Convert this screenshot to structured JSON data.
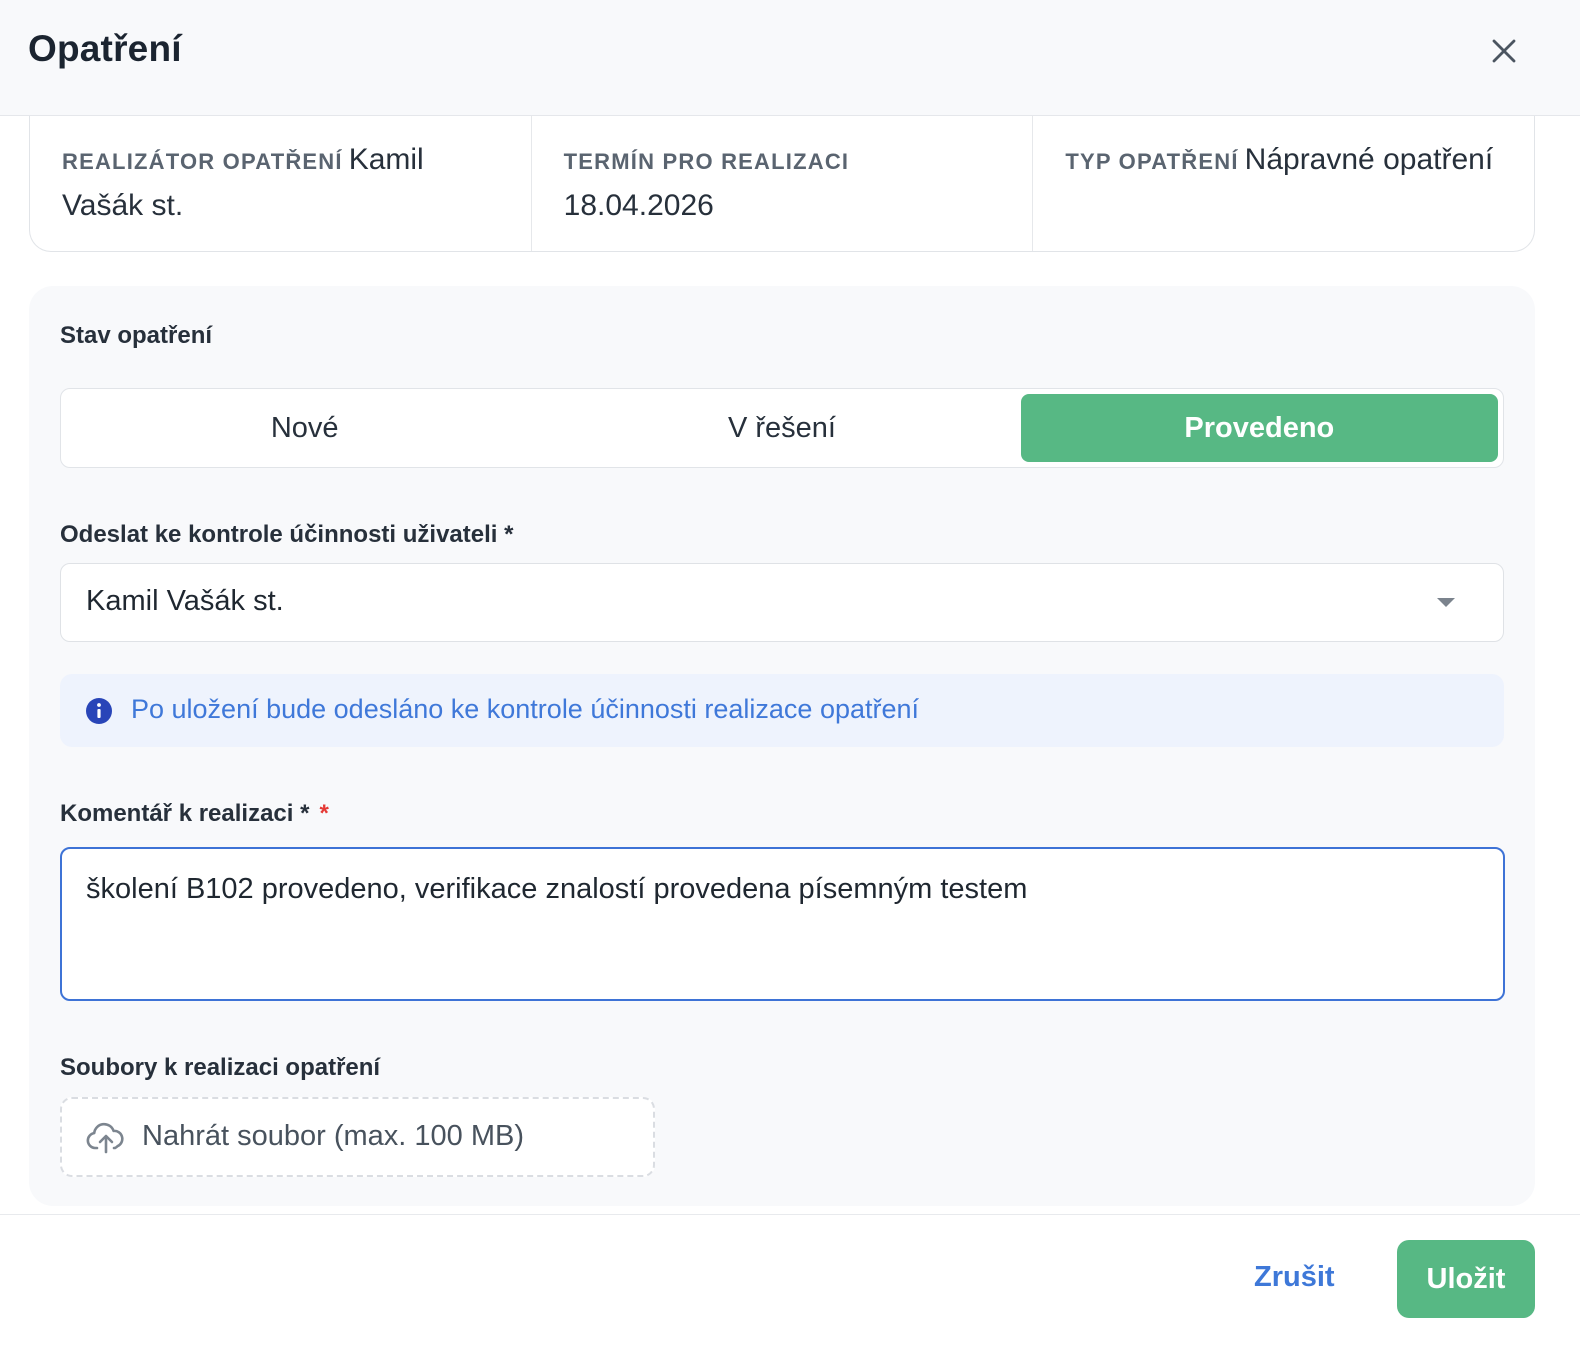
{
  "header": {
    "title": "Opatření",
    "close_icon": "close-icon"
  },
  "info": {
    "realizator": {
      "label": "Realizátor opatření",
      "value": "Kamil Vašák st."
    },
    "termin": {
      "label": "Termín pro realizaci",
      "value": "18.04.2026"
    },
    "typ": {
      "label": "Typ opatření",
      "value": "Nápravné opatření"
    }
  },
  "form": {
    "status": {
      "label": "Stav opatření",
      "options": [
        "Nové",
        "V řešení",
        "Provedeno"
      ],
      "selected": "Provedeno"
    },
    "reviewer": {
      "label": "Odeslat ke kontrole účinnosti uživateli *",
      "value": "Kamil Vašák st."
    },
    "notice": {
      "icon": "info-icon",
      "text": "Po uložení bude odesláno ke kontrole účinnosti realizace opatření"
    },
    "comment": {
      "label": "Komentář k realizaci *",
      "required_marker": "*",
      "value": "školení B102 provedeno, verifikace znalostí provedena písemným testem"
    },
    "files": {
      "label": "Soubory k realizaci opatření",
      "upload_icon": "cloud-upload-icon",
      "upload_label": "Nahrát soubor (max. 100 MB)"
    }
  },
  "footer": {
    "cancel_label": "Zrušit",
    "save_label": "Uložit"
  },
  "colors": {
    "accent_green": "#57b884",
    "link_blue": "#3e78d8",
    "notice_bg": "#eef3fd",
    "required_red": "#e53935"
  }
}
